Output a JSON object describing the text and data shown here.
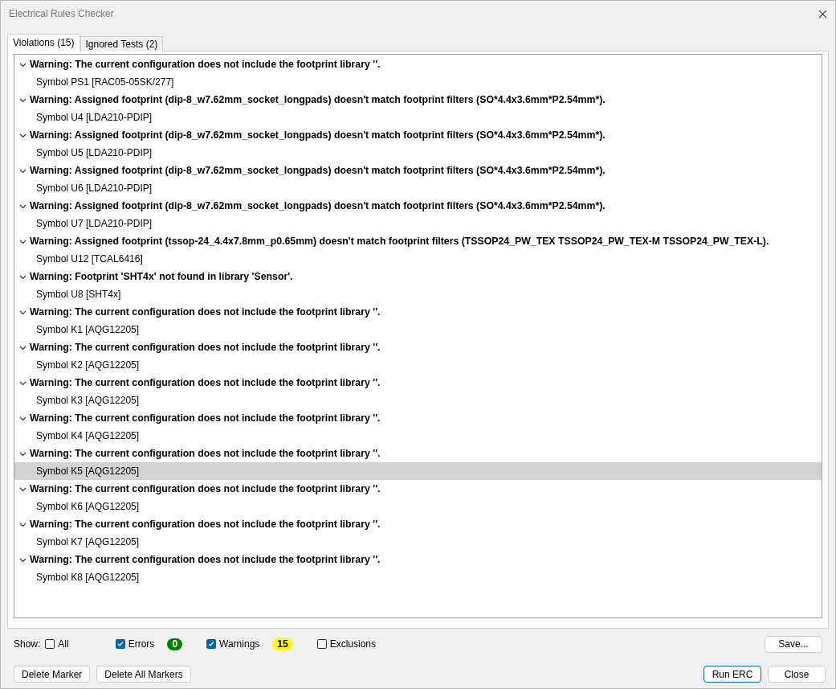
{
  "window": {
    "title": "Electrical Rules Checker"
  },
  "tabs": [
    {
      "label": "Violations (15)",
      "selected": true
    },
    {
      "label": "Ignored Tests (2)",
      "selected": false
    }
  ],
  "violations": [
    {
      "text": "Warning: The current configuration does not include the footprint library ''.",
      "expanded": true,
      "children": [
        {
          "text": "Symbol PS1 [RAC05-05SK/277]",
          "selected": false
        }
      ]
    },
    {
      "text": "Warning: Assigned footprint (dip-8_w7.62mm_socket_longpads) doesn't match footprint filters (SO*4.4x3.6mm*P2.54mm*).",
      "expanded": true,
      "children": [
        {
          "text": "Symbol U4 [LDA210-PDIP]",
          "selected": false
        }
      ]
    },
    {
      "text": "Warning: Assigned footprint (dip-8_w7.62mm_socket_longpads) doesn't match footprint filters (SO*4.4x3.6mm*P2.54mm*).",
      "expanded": true,
      "children": [
        {
          "text": "Symbol U5 [LDA210-PDIP]",
          "selected": false
        }
      ]
    },
    {
      "text": "Warning: Assigned footprint (dip-8_w7.62mm_socket_longpads) doesn't match footprint filters (SO*4.4x3.6mm*P2.54mm*).",
      "expanded": true,
      "children": [
        {
          "text": "Symbol U6 [LDA210-PDIP]",
          "selected": false
        }
      ]
    },
    {
      "text": "Warning: Assigned footprint (dip-8_w7.62mm_socket_longpads) doesn't match footprint filters (SO*4.4x3.6mm*P2.54mm*).",
      "expanded": true,
      "children": [
        {
          "text": "Symbol U7 [LDA210-PDIP]",
          "selected": false
        }
      ]
    },
    {
      "text": "Warning: Assigned footprint (tssop-24_4.4x7.8mm_p0.65mm) doesn't match footprint filters (TSSOP24_PW_TEX TSSOP24_PW_TEX-M TSSOP24_PW_TEX-L).",
      "expanded": true,
      "children": [
        {
          "text": "Symbol U12 [TCAL6416]",
          "selected": false
        }
      ]
    },
    {
      "text": "Warning: Footprint 'SHT4x' not found in library 'Sensor'.",
      "expanded": true,
      "children": [
        {
          "text": "Symbol U8 [SHT4x]",
          "selected": false
        }
      ]
    },
    {
      "text": "Warning: The current configuration does not include the footprint library ''.",
      "expanded": true,
      "children": [
        {
          "text": "Symbol K1 [AQG12205]",
          "selected": false
        }
      ]
    },
    {
      "text": "Warning: The current configuration does not include the footprint library ''.",
      "expanded": true,
      "children": [
        {
          "text": "Symbol K2 [AQG12205]",
          "selected": false
        }
      ]
    },
    {
      "text": "Warning: The current configuration does not include the footprint library ''.",
      "expanded": true,
      "children": [
        {
          "text": "Symbol K3 [AQG12205]",
          "selected": false
        }
      ]
    },
    {
      "text": "Warning: The current configuration does not include the footprint library ''.",
      "expanded": true,
      "children": [
        {
          "text": "Symbol K4 [AQG12205]",
          "selected": false
        }
      ]
    },
    {
      "text": "Warning: The current configuration does not include the footprint library ''.",
      "expanded": true,
      "children": [
        {
          "text": "Symbol K5 [AQG12205]",
          "selected": true
        }
      ]
    },
    {
      "text": "Warning: The current configuration does not include the footprint library ''.",
      "expanded": true,
      "children": [
        {
          "text": "Symbol K6 [AQG12205]",
          "selected": false
        }
      ]
    },
    {
      "text": "Warning: The current configuration does not include the footprint library ''.",
      "expanded": true,
      "children": [
        {
          "text": "Symbol K7 [AQG12205]",
          "selected": false
        }
      ]
    },
    {
      "text": "Warning: The current configuration does not include the footprint library ''.",
      "expanded": true,
      "children": [
        {
          "text": "Symbol K8 [AQG12205]",
          "selected": false
        }
      ]
    }
  ],
  "filters": {
    "label": "Show:",
    "items": [
      {
        "kind": "plain",
        "label": "All",
        "checked": false
      },
      {
        "kind": "counted",
        "label": "Errors",
        "checked": true,
        "count": "0",
        "color": "#008000"
      },
      {
        "kind": "counted",
        "label": "Warnings",
        "checked": true,
        "count": "15",
        "color": "#ffff00"
      },
      {
        "kind": "plain",
        "label": "Exclusions",
        "checked": false
      }
    ]
  },
  "save_button": "Save...",
  "left_buttons": [
    "Delete Marker",
    "Delete All Markers"
  ],
  "right_buttons": [
    {
      "label": "Run ERC",
      "default": true
    },
    {
      "label": "Close",
      "default": false
    }
  ]
}
